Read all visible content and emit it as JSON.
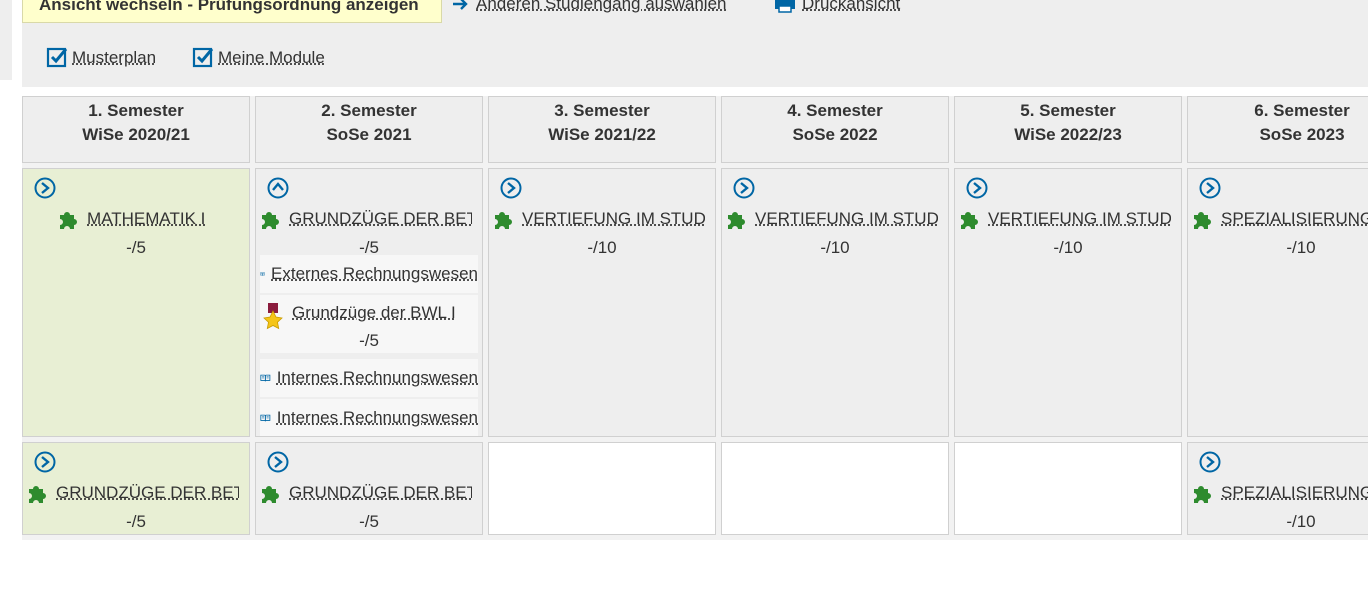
{
  "toolbar": {
    "toggle_view": "Ansicht wechseln - Prüfungsordnung anzeigen",
    "other_program": "Anderen Studiengang auswählen",
    "print_view": "Druckansicht"
  },
  "filters": {
    "musterplan": "Musterplan",
    "meine_module": "Meine Module"
  },
  "semesters": [
    {
      "title": "1. Semester",
      "term": "WiSe 2020/21"
    },
    {
      "title": "2. Semester",
      "term": "SoSe 2021"
    },
    {
      "title": "3. Semester",
      "term": "WiSe 2021/22"
    },
    {
      "title": "4. Semester",
      "term": "SoSe 2022"
    },
    {
      "title": "5. Semester",
      "term": "WiSe 2022/23"
    },
    {
      "title": "6. Semester",
      "term": "SoSe 2023"
    }
  ],
  "row1": [
    {
      "module": "MATHEMATIK I",
      "credits": "-/5"
    },
    {
      "module": "GRUNDZÜGE DER BETRIEBSWIRTSCHAFTSLEHRE",
      "credits": "-/5",
      "courses": [
        {
          "name": "Externes Rechnungswesen"
        },
        {
          "name": "Grundzüge der BWL I",
          "credits": "-/5"
        },
        {
          "name": "Internes Rechnungswesen"
        },
        {
          "name": "Internes Rechnungswesen"
        }
      ]
    },
    {
      "module": "VERTIEFUNG IM STUDIENSCHWERPUNKT",
      "credits": "-/10"
    },
    {
      "module": "VERTIEFUNG IM STUDIENSCHWERPUNKT",
      "credits": "-/10"
    },
    {
      "module": "VERTIEFUNG IM STUDIENSCHWERPUNKT",
      "credits": "-/10"
    },
    {
      "module": "SPEZIALISIERUNG",
      "credits": "-/10"
    }
  ],
  "row2": [
    {
      "module": "GRUNDZÜGE DER BETRIEBSWIRTSCHAFTSLEHRE",
      "credits": "-/5"
    },
    {
      "module": "GRUNDZÜGE DER BETRIEBSWIRTSCHAFTSLEHRE",
      "credits": "-/5"
    },
    {},
    {},
    {},
    {
      "module": "SPEZIALISIERUNG",
      "credits": "-/10"
    }
  ],
  "colors": {
    "accent": "#0066a5",
    "puzzle": "#2e8b2e",
    "green_cell": "#e8efd4"
  }
}
